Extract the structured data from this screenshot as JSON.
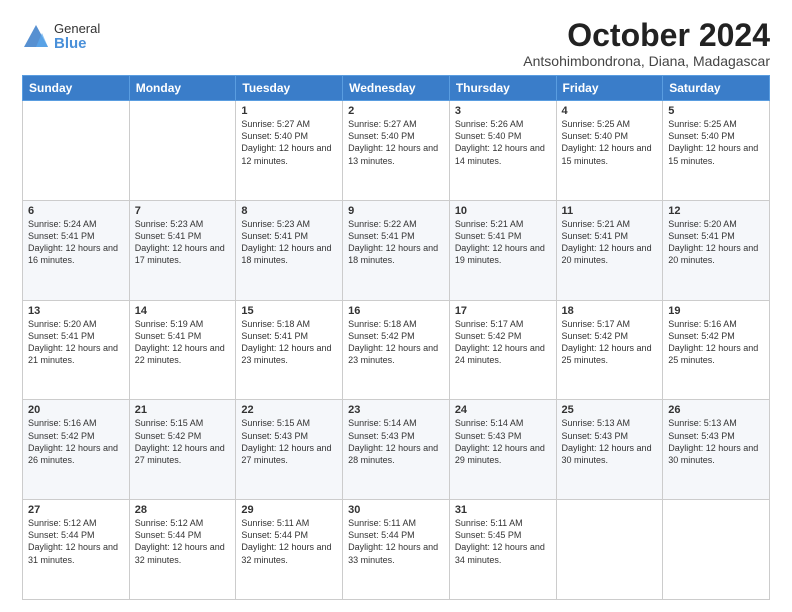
{
  "logo": {
    "general": "General",
    "blue": "Blue"
  },
  "header": {
    "month": "October 2024",
    "location": "Antsohimbondrona, Diana, Madagascar"
  },
  "weekdays": [
    "Sunday",
    "Monday",
    "Tuesday",
    "Wednesday",
    "Thursday",
    "Friday",
    "Saturday"
  ],
  "weeks": [
    [
      {
        "day": "",
        "sunrise": "",
        "sunset": "",
        "daylight": ""
      },
      {
        "day": "",
        "sunrise": "",
        "sunset": "",
        "daylight": ""
      },
      {
        "day": "1",
        "sunrise": "Sunrise: 5:27 AM",
        "sunset": "Sunset: 5:40 PM",
        "daylight": "Daylight: 12 hours and 12 minutes."
      },
      {
        "day": "2",
        "sunrise": "Sunrise: 5:27 AM",
        "sunset": "Sunset: 5:40 PM",
        "daylight": "Daylight: 12 hours and 13 minutes."
      },
      {
        "day": "3",
        "sunrise": "Sunrise: 5:26 AM",
        "sunset": "Sunset: 5:40 PM",
        "daylight": "Daylight: 12 hours and 14 minutes."
      },
      {
        "day": "4",
        "sunrise": "Sunrise: 5:25 AM",
        "sunset": "Sunset: 5:40 PM",
        "daylight": "Daylight: 12 hours and 15 minutes."
      },
      {
        "day": "5",
        "sunrise": "Sunrise: 5:25 AM",
        "sunset": "Sunset: 5:40 PM",
        "daylight": "Daylight: 12 hours and 15 minutes."
      }
    ],
    [
      {
        "day": "6",
        "sunrise": "Sunrise: 5:24 AM",
        "sunset": "Sunset: 5:41 PM",
        "daylight": "Daylight: 12 hours and 16 minutes."
      },
      {
        "day": "7",
        "sunrise": "Sunrise: 5:23 AM",
        "sunset": "Sunset: 5:41 PM",
        "daylight": "Daylight: 12 hours and 17 minutes."
      },
      {
        "day": "8",
        "sunrise": "Sunrise: 5:23 AM",
        "sunset": "Sunset: 5:41 PM",
        "daylight": "Daylight: 12 hours and 18 minutes."
      },
      {
        "day": "9",
        "sunrise": "Sunrise: 5:22 AM",
        "sunset": "Sunset: 5:41 PM",
        "daylight": "Daylight: 12 hours and 18 minutes."
      },
      {
        "day": "10",
        "sunrise": "Sunrise: 5:21 AM",
        "sunset": "Sunset: 5:41 PM",
        "daylight": "Daylight: 12 hours and 19 minutes."
      },
      {
        "day": "11",
        "sunrise": "Sunrise: 5:21 AM",
        "sunset": "Sunset: 5:41 PM",
        "daylight": "Daylight: 12 hours and 20 minutes."
      },
      {
        "day": "12",
        "sunrise": "Sunrise: 5:20 AM",
        "sunset": "Sunset: 5:41 PM",
        "daylight": "Daylight: 12 hours and 20 minutes."
      }
    ],
    [
      {
        "day": "13",
        "sunrise": "Sunrise: 5:20 AM",
        "sunset": "Sunset: 5:41 PM",
        "daylight": "Daylight: 12 hours and 21 minutes."
      },
      {
        "day": "14",
        "sunrise": "Sunrise: 5:19 AM",
        "sunset": "Sunset: 5:41 PM",
        "daylight": "Daylight: 12 hours and 22 minutes."
      },
      {
        "day": "15",
        "sunrise": "Sunrise: 5:18 AM",
        "sunset": "Sunset: 5:41 PM",
        "daylight": "Daylight: 12 hours and 23 minutes."
      },
      {
        "day": "16",
        "sunrise": "Sunrise: 5:18 AM",
        "sunset": "Sunset: 5:42 PM",
        "daylight": "Daylight: 12 hours and 23 minutes."
      },
      {
        "day": "17",
        "sunrise": "Sunrise: 5:17 AM",
        "sunset": "Sunset: 5:42 PM",
        "daylight": "Daylight: 12 hours and 24 minutes."
      },
      {
        "day": "18",
        "sunrise": "Sunrise: 5:17 AM",
        "sunset": "Sunset: 5:42 PM",
        "daylight": "Daylight: 12 hours and 25 minutes."
      },
      {
        "day": "19",
        "sunrise": "Sunrise: 5:16 AM",
        "sunset": "Sunset: 5:42 PM",
        "daylight": "Daylight: 12 hours and 25 minutes."
      }
    ],
    [
      {
        "day": "20",
        "sunrise": "Sunrise: 5:16 AM",
        "sunset": "Sunset: 5:42 PM",
        "daylight": "Daylight: 12 hours and 26 minutes."
      },
      {
        "day": "21",
        "sunrise": "Sunrise: 5:15 AM",
        "sunset": "Sunset: 5:42 PM",
        "daylight": "Daylight: 12 hours and 27 minutes."
      },
      {
        "day": "22",
        "sunrise": "Sunrise: 5:15 AM",
        "sunset": "Sunset: 5:43 PM",
        "daylight": "Daylight: 12 hours and 27 minutes."
      },
      {
        "day": "23",
        "sunrise": "Sunrise: 5:14 AM",
        "sunset": "Sunset: 5:43 PM",
        "daylight": "Daylight: 12 hours and 28 minutes."
      },
      {
        "day": "24",
        "sunrise": "Sunrise: 5:14 AM",
        "sunset": "Sunset: 5:43 PM",
        "daylight": "Daylight: 12 hours and 29 minutes."
      },
      {
        "day": "25",
        "sunrise": "Sunrise: 5:13 AM",
        "sunset": "Sunset: 5:43 PM",
        "daylight": "Daylight: 12 hours and 30 minutes."
      },
      {
        "day": "26",
        "sunrise": "Sunrise: 5:13 AM",
        "sunset": "Sunset: 5:43 PM",
        "daylight": "Daylight: 12 hours and 30 minutes."
      }
    ],
    [
      {
        "day": "27",
        "sunrise": "Sunrise: 5:12 AM",
        "sunset": "Sunset: 5:44 PM",
        "daylight": "Daylight: 12 hours and 31 minutes."
      },
      {
        "day": "28",
        "sunrise": "Sunrise: 5:12 AM",
        "sunset": "Sunset: 5:44 PM",
        "daylight": "Daylight: 12 hours and 32 minutes."
      },
      {
        "day": "29",
        "sunrise": "Sunrise: 5:11 AM",
        "sunset": "Sunset: 5:44 PM",
        "daylight": "Daylight: 12 hours and 32 minutes."
      },
      {
        "day": "30",
        "sunrise": "Sunrise: 5:11 AM",
        "sunset": "Sunset: 5:44 PM",
        "daylight": "Daylight: 12 hours and 33 minutes."
      },
      {
        "day": "31",
        "sunrise": "Sunrise: 5:11 AM",
        "sunset": "Sunset: 5:45 PM",
        "daylight": "Daylight: 12 hours and 34 minutes."
      },
      {
        "day": "",
        "sunrise": "",
        "sunset": "",
        "daylight": ""
      },
      {
        "day": "",
        "sunrise": "",
        "sunset": "",
        "daylight": ""
      }
    ]
  ]
}
